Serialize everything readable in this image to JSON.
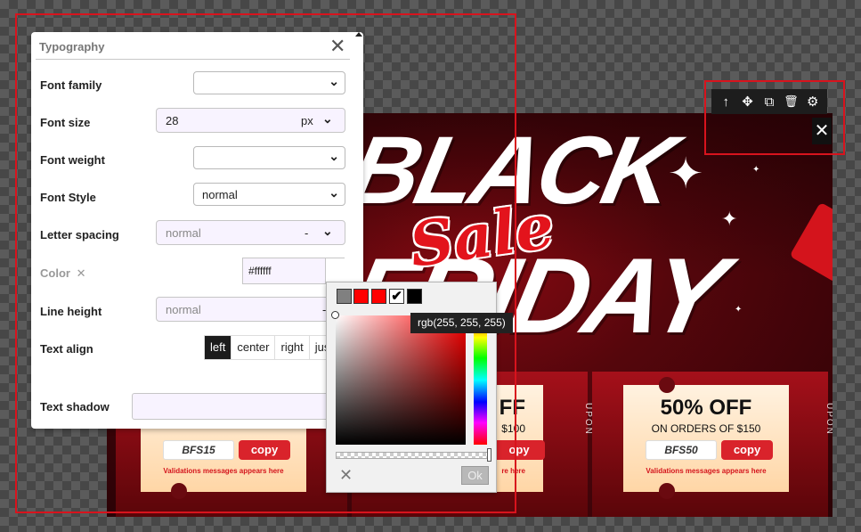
{
  "banner": {
    "headline_top": "BLACK",
    "headline_bottom": "FRIDAY",
    "script_word": "Sale",
    "coupons": [
      {
        "percent": "",
        "subtitle": "",
        "code": "BFS15",
        "copy_label": "copy",
        "validation": "Validations messages appears here"
      },
      {
        "percent": "FF",
        "subtitle": "$100",
        "code": "",
        "copy_label": "opy",
        "validation": "re here"
      },
      {
        "percent": "50% OFF",
        "subtitle": "ON ORDERS OF $150",
        "code": "BFS50",
        "copy_label": "copy",
        "validation": "Validations messages appears here"
      }
    ],
    "side_text": "UPON"
  },
  "element_toolbar": {
    "icons": [
      "arrow-up-icon",
      "move-icon",
      "copy-icon",
      "trash-icon",
      "gear-icon"
    ],
    "up": "↑",
    "move": "✥",
    "copy": "⧉",
    "delete": "🗑",
    "settings": "⚙",
    "close": "✕"
  },
  "typography_panel": {
    "title": "Typography",
    "close": "✕",
    "font_family": {
      "label": "Font family",
      "value": ""
    },
    "font_size": {
      "label": "Font size",
      "value": "28",
      "unit": "px"
    },
    "font_weight": {
      "label": "Font weight",
      "value": ""
    },
    "font_style": {
      "label": "Font Style",
      "value": "normal"
    },
    "letter_spacing": {
      "label": "Letter spacing",
      "value": "normal",
      "unit": "-"
    },
    "color": {
      "label": "Color",
      "clear": "✕",
      "value": "#ffffff"
    },
    "line_height": {
      "label": "Line height",
      "value": "normal",
      "unit": "-"
    },
    "text_align": {
      "label": "Text align",
      "options": [
        "left",
        "center",
        "right",
        "just"
      ],
      "selected": "left"
    },
    "text_shadow": {
      "label": "Text shadow",
      "value": ""
    }
  },
  "color_picker": {
    "palette": [
      "#808080",
      "#ff0000",
      "#ff0000",
      "#ffffff",
      "#000000"
    ],
    "selected_check": "✔",
    "tooltip": "rgb(255, 255, 255)",
    "cancel": "✕",
    "ok": "Ok"
  },
  "colors": {
    "accent": "#d8131d",
    "panel_bg": "#ffffff",
    "active_btn": "#1c1c1c"
  }
}
